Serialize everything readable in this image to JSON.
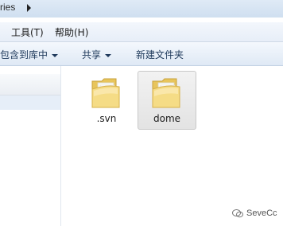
{
  "address_bar": {
    "path_fragment": "ries"
  },
  "menu": {
    "tools": "工具(T)",
    "help": "帮助(H)"
  },
  "toolbar": {
    "include_in_library": "包含到库中",
    "share": "共享",
    "new_folder": "新建文件夹"
  },
  "files": [
    {
      "name": ".svn",
      "icon": "folder-icon",
      "selected": false
    },
    {
      "name": "dome",
      "icon": "folder-icon",
      "selected": true
    }
  ],
  "watermark": {
    "text": "SeveCc",
    "icon": "wechat-icon"
  },
  "colors": {
    "address_bar": "#cfdff0",
    "menu_bar": "#e7eef8",
    "toolbar_text": "#1e395b",
    "folder": "#f2d77a",
    "selection": "#e3e3e3"
  }
}
